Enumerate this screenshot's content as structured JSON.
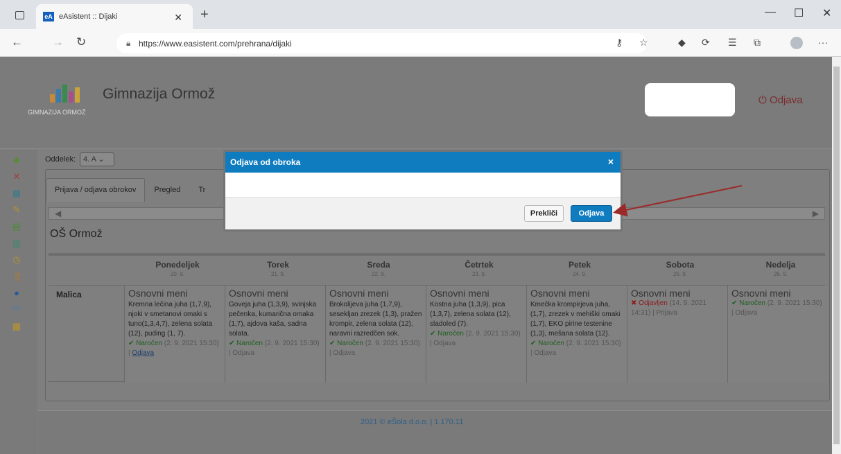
{
  "browser": {
    "tab_title": "eAsistent :: Dijaki",
    "favicon_text": "eA",
    "url": "https://www.easistent.com/prehrana/dijaki"
  },
  "header": {
    "logo_text": "GIMNAZIJA ORMOŽ",
    "school_name": "Gimnazija Ormož",
    "logout_label": "Odjava"
  },
  "filter": {
    "label": "Oddelek:",
    "value": "4. A"
  },
  "tabs": [
    "Prijava / odjava obrokov",
    "Pregled",
    "Tr"
  ],
  "section_title": "OŠ Ormož",
  "days": [
    {
      "name": "Ponedeljek",
      "date": "20. 9."
    },
    {
      "name": "Torek",
      "date": "21. 9."
    },
    {
      "name": "Sreda",
      "date": "22. 9."
    },
    {
      "name": "Četrtek",
      "date": "23. 9."
    },
    {
      "name": "Petek",
      "date": "24. 9."
    },
    {
      "name": "Sobota",
      "date": "25. 9."
    },
    {
      "name": "Nedelja",
      "date": "26. 9."
    }
  ],
  "row_label": "Malica",
  "meals": [
    {
      "menu": "Osnovni meni",
      "desc": "Kremna lečina juha (1,7,9), njoki v smetanovi omaki s tuno(1,3,4,7), zelena solata (12), puding (1, 7).",
      "status": "Naročen",
      "when": "(2. 9. 2021 15:30)",
      "action": "Odjava"
    },
    {
      "menu": "Osnovni meni",
      "desc": "Goveja juha (1,3,9), svinjska pečenka, kumarična omaka (1,7), ajdova kaša, sadna solata.",
      "status": "Naročen",
      "when": "(2. 9. 2021 15:30)",
      "action": "Odjava"
    },
    {
      "menu": "Osnovni meni",
      "desc": "Brokolijeva juha (1,7,9), sesekljan zrezek (1,3), pražen krompir, zelena solata (12), naravni razredčen sok.",
      "status": "Naročen",
      "when": "(2. 9. 2021 15:30)",
      "action": "Odjava"
    },
    {
      "menu": "Osnovni meni",
      "desc": "Kostna juha (1,3,9), pica (1,3,7), zelena solata (12), sladoled (7).",
      "status": "Naročen",
      "when": "(2. 9. 2021 15:30)",
      "action": "Odjava"
    },
    {
      "menu": "Osnovni meni",
      "desc": "Kmečka krompirjeva juha, (1,7), zrezek v mehiški omaki (1,7), EKO pirine testenine (1,3), mešana solata (12).",
      "status": "Naročen",
      "when": "(2. 9. 2021 15:30)",
      "action": "Odjava"
    },
    {
      "menu": "Osnovni meni",
      "desc": "",
      "status": "Odjavljen",
      "when": "(14. 9. 2021 14:31)",
      "action": "Prijava"
    },
    {
      "menu": "Osnovni meni",
      "desc": "",
      "status": "Naročen",
      "when": "(2. 9. 2021 15:30)",
      "action": "Odjava"
    }
  ],
  "modal": {
    "title": "Odjava od obroka",
    "close": "×",
    "cancel_label": "Prekliči",
    "confirm_label": "Odjava"
  },
  "footer": "2021 © eŠola d.o.o.   |   1.170.11",
  "colors": {
    "accent": "#0f7cc0",
    "ok": "#1f5e1f",
    "cancelled": "#8a1d1d",
    "annotation_arrow": "#9b2a2a"
  }
}
